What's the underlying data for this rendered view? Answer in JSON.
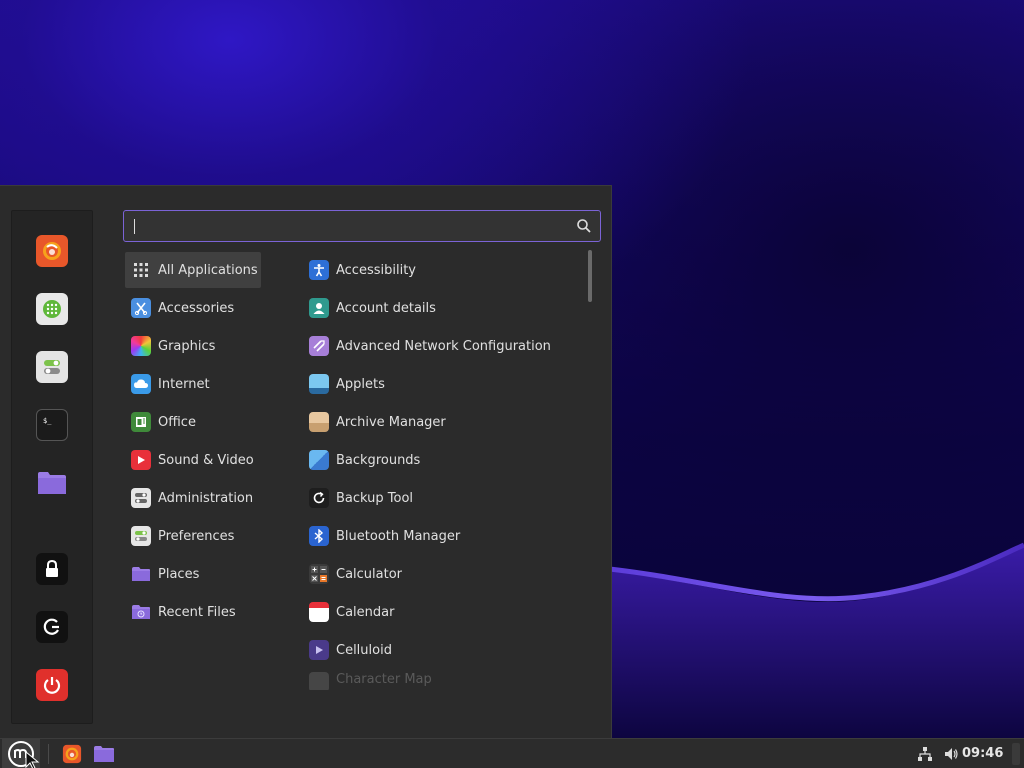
{
  "search": {
    "value": "",
    "placeholder": ""
  },
  "favorites": [
    "Firefox Web Browser",
    "Software Manager",
    "System Settings",
    "Terminal",
    "Files"
  ],
  "session": [
    "Lock Screen",
    "Logout",
    "Quit"
  ],
  "categories": [
    {
      "label": "All Applications",
      "icon": "grid-icon"
    },
    {
      "label": "Accessories",
      "icon": "accessories-icon"
    },
    {
      "label": "Graphics",
      "icon": "graphics-icon"
    },
    {
      "label": "Internet",
      "icon": "internet-icon"
    },
    {
      "label": "Office",
      "icon": "office-icon"
    },
    {
      "label": "Sound & Video",
      "icon": "sound-video-icon"
    },
    {
      "label": "Administration",
      "icon": "administration-icon"
    },
    {
      "label": "Preferences",
      "icon": "preferences-icon"
    },
    {
      "label": "Places",
      "icon": "folder-icon"
    },
    {
      "label": "Recent Files",
      "icon": "recent-files-icon"
    }
  ],
  "apps": [
    {
      "label": "Accessibility",
      "icon": "accessibility-icon"
    },
    {
      "label": "Account details",
      "icon": "account-icon"
    },
    {
      "label": "Advanced Network Configuration",
      "icon": "network-config-icon"
    },
    {
      "label": "Applets",
      "icon": "applets-icon"
    },
    {
      "label": "Archive Manager",
      "icon": "archive-icon"
    },
    {
      "label": "Backgrounds",
      "icon": "backgrounds-icon"
    },
    {
      "label": "Backup Tool",
      "icon": "backup-icon"
    },
    {
      "label": "Bluetooth Manager",
      "icon": "bluetooth-icon"
    },
    {
      "label": "Calculator",
      "icon": "calculator-icon"
    },
    {
      "label": "Calendar",
      "icon": "calendar-icon"
    },
    {
      "label": "Celluloid",
      "icon": "celluloid-icon"
    },
    {
      "label": "Character Map",
      "icon": "character-map-icon"
    }
  ],
  "panel": {
    "clock": "09:46"
  },
  "colors": {
    "accent": "#7b63d6",
    "menu_bg": "#2b2b2b",
    "panel_bg": "#2c2c2c"
  }
}
